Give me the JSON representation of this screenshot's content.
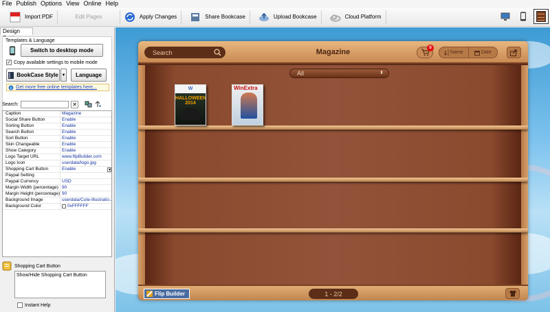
{
  "menubar": {
    "items": [
      "File",
      "Publish",
      "Options",
      "View",
      "Online",
      "Help"
    ]
  },
  "toolbar": {
    "import_pdf": "Import PDF",
    "edit_pages": "Edit Pages",
    "apply_changes": "Apply Changes",
    "share_bookcase": "Share Bookcase",
    "upload_bookcase": "Upload Bookcase",
    "cloud_platform": "Cloud Platform"
  },
  "left": {
    "tab": "Design Settings",
    "group_title": "Templates & Language",
    "switch_btn": "Switch to desktop mode",
    "copy_label": "Copy available settings to mobile mode",
    "copy_checked": "✓",
    "style_btn": "BookCase Style",
    "lang_btn": "Language",
    "more_link": "Get more free online templates here...",
    "search_label": "Search:",
    "props": [
      {
        "k": "Caption",
        "v": "Magazine"
      },
      {
        "k": "Social Share Button",
        "v": "Enable"
      },
      {
        "k": "Sorting Button",
        "v": "Enable"
      },
      {
        "k": "Search Button",
        "v": "Enable"
      },
      {
        "k": "Sort Button",
        "v": "Enable"
      },
      {
        "k": "Skin Changeable",
        "v": "Enable"
      },
      {
        "k": "Show Category",
        "v": "Enable"
      },
      {
        "k": "Logo Target URL",
        "v": "www.flipBuilder.com"
      },
      {
        "k": "Logo Icon",
        "v": "userdata/logo.jpg"
      },
      {
        "k": "Shopping Cart Button",
        "v": "Enable"
      },
      {
        "k": "Paypal Setting",
        "v": ""
      },
      {
        "k": "Paypal Currency",
        "v": "USD"
      },
      {
        "k": "Margin Width (percentage)",
        "v": "90"
      },
      {
        "k": "Margin Height (percentage)",
        "v": "90"
      },
      {
        "k": "Background Image",
        "v": "userdata/Cute-Illustratio..."
      },
      {
        "k": "Background Color",
        "v": "0xFFFFFF"
      }
    ],
    "help_title": "Shopping Cart Button",
    "help_text": "Show/Hide Shopping Cart Button",
    "instant_help": "Instant Help"
  },
  "bookcase": {
    "search_placeholder": "Search",
    "title": "Magazine",
    "cart_count": "0",
    "sort_name": "Name",
    "sort_date": "Date",
    "category": "All",
    "book1_title": "HALLOWEEN 2014",
    "book1_top": "W",
    "book2_title": "WinExtra",
    "logo": "Flip Builder",
    "page": "1 - 2/2"
  },
  "colors": {
    "accent": "#1030a0",
    "wood": "#93533a",
    "sky": "#7ec3ee"
  }
}
